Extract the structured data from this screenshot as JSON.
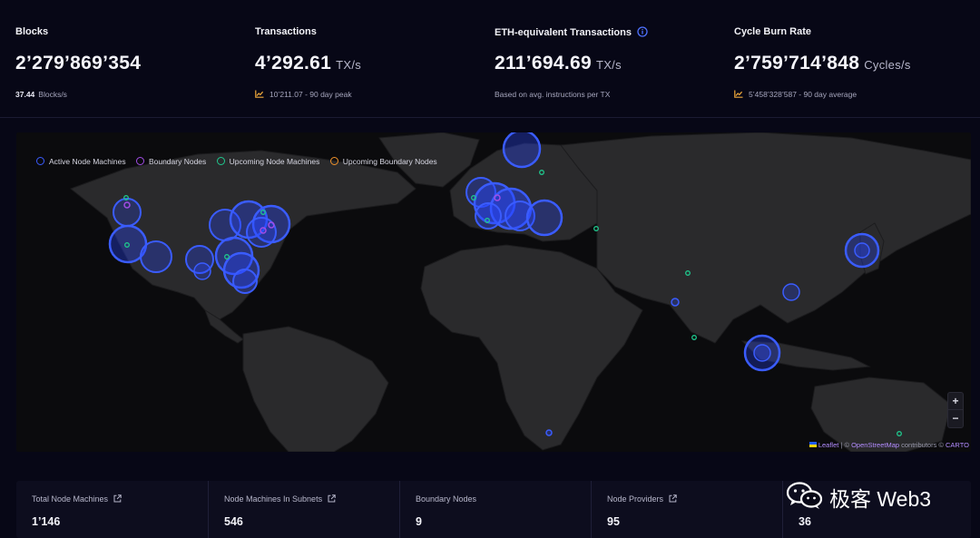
{
  "stats": [
    {
      "label": "Blocks",
      "value": "2’279’869’354",
      "unit": "",
      "sub_value": "37.44",
      "sub_text": "Blocks/s",
      "icon": ""
    },
    {
      "label": "Transactions",
      "value": "4’292.61",
      "unit": "TX/s",
      "sub_value": "",
      "sub_text": "10’211.07 - 90 day peak",
      "icon": "trend-icon"
    },
    {
      "label": "ETH-equivalent Transactions",
      "value": "211’694.69",
      "unit": "TX/s",
      "sub_value": "",
      "sub_text": "Based on avg. instructions per TX",
      "icon": "info-icon"
    },
    {
      "label": "Cycle Burn Rate",
      "value": "2’759’714’848",
      "unit": "Cycles/s",
      "sub_value": "",
      "sub_text": "5’458’328’587 - 90 day average",
      "icon": "trend-icon"
    }
  ],
  "map": {
    "legend": [
      {
        "label": "Active Node Machines",
        "color": "#3a5cff"
      },
      {
        "label": "Boundary Nodes",
        "color": "#a24de6"
      },
      {
        "label": "Upcoming Node Machines",
        "color": "#1fc98e"
      },
      {
        "label": "Upcoming Boundary Nodes",
        "color": "#f0922b"
      }
    ],
    "zoom_in": "+",
    "zoom_out": "−",
    "attribution": {
      "leaflet": "Leaflet",
      "sep1": " | © ",
      "osm": "OpenStreetMap",
      "mid": " contributors © ",
      "carto": "CARTO"
    }
  },
  "cards": [
    {
      "label": "Total Node Machines",
      "value": "1’146",
      "link": true
    },
    {
      "label": "Node Machines In Subnets",
      "value": "546",
      "link": true
    },
    {
      "label": "Boundary Nodes",
      "value": "9",
      "link": false
    },
    {
      "label": "Node Providers",
      "value": "95",
      "link": true
    },
    {
      "label": "",
      "value": "36",
      "link": false
    }
  ],
  "watermark": {
    "text": "极客 Web3"
  },
  "colors": {
    "active": "#3a5cff",
    "boundary": "#a24de6",
    "upcoming": "#1fc98e",
    "accent_trend": "#f0a93b"
  }
}
